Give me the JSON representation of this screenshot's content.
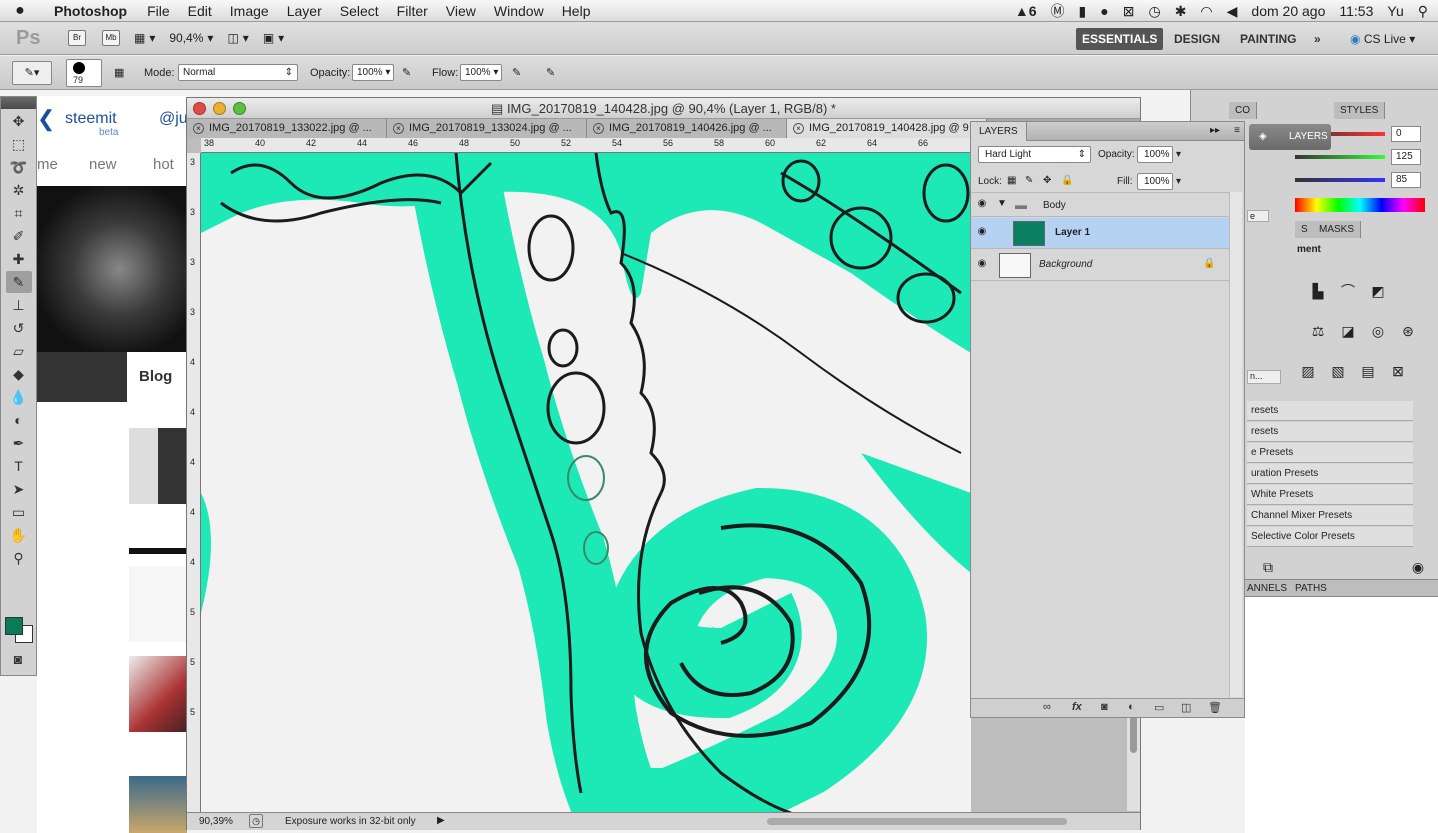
{
  "menubar": {
    "app_name": "Photoshop",
    "menus": [
      "File",
      "Edit",
      "Image",
      "Layer",
      "Select",
      "Filter",
      "View",
      "Window",
      "Help"
    ],
    "tray": {
      "adobe_badge": "6",
      "date": "dom 20 ago",
      "time": "11:53",
      "user": "Yu"
    }
  },
  "appbar": {
    "logo": "Ps",
    "bridge": "Br",
    "minibridge": "Mb",
    "zoom": "90,4%",
    "workspaces": [
      "ESSENTIALS",
      "DESIGN",
      "PAINTING"
    ],
    "more": "»",
    "cs_live": "CS Live"
  },
  "options": {
    "brush_size": "79",
    "mode_label": "Mode:",
    "mode_value": "Normal",
    "opacity_label": "Opacity:",
    "opacity_value": "100%",
    "flow_label": "Flow:",
    "flow_value": "100%"
  },
  "browser": {
    "brand": "steemit",
    "beta": "beta",
    "handle": "@ju",
    "nav": [
      "me",
      "new",
      "hot"
    ],
    "blog_tab": "Blog"
  },
  "document": {
    "title": "IMG_20170819_140428.jpg @ 90,4% (Layer 1, RGB/8) *",
    "tabs": [
      "IMG_20170819_133022.jpg @ ...",
      "IMG_20170819_133024.jpg @ ...",
      "IMG_20170819_140426.jpg @ ...",
      "IMG_20170819_140428.jpg @ 9"
    ],
    "ruler_h": [
      "38",
      "40",
      "42",
      "44",
      "46",
      "48",
      "50",
      "52",
      "54",
      "56",
      "58",
      "60",
      "62",
      "64",
      "66"
    ],
    "ruler_v": [
      "3",
      "3",
      "3",
      "3",
      "4",
      "4",
      "4",
      "4",
      "4",
      "5",
      "5",
      "5"
    ],
    "zoom_status": "90,39%",
    "status_message": "Exposure works in 32-bit only"
  },
  "layers_panel": {
    "title": "LAYERS",
    "blend_mode": "Hard Light",
    "opacity_label": "Opacity:",
    "opacity_value": "100%",
    "lock_label": "Lock:",
    "fill_label": "Fill:",
    "fill_value": "100%",
    "layers": [
      {
        "name": "Body",
        "type": "group"
      },
      {
        "name": "Layer 1",
        "type": "layer",
        "selected": true
      },
      {
        "name": "Background",
        "type": "background",
        "locked": true
      }
    ]
  },
  "right_panels": {
    "tab_co": "CO",
    "tab_styles": "STYLES",
    "layers_button": "LAYERS",
    "tab_s": "S",
    "tab_masks": "MASKS",
    "adjustments_title": "ment",
    "color_values": [
      "0",
      "125",
      "85"
    ],
    "presets": [
      "resets",
      "resets",
      "e Presets",
      "uration Presets",
      "White Presets",
      "Channel Mixer Presets",
      "Selective Color Presets"
    ],
    "fragments": [
      "e",
      "n..."
    ],
    "channels_tab": "ANNELS",
    "paths_tab": "PATHS"
  },
  "colors": {
    "foreground": "#0a7a5a",
    "background": "#ffffff",
    "paint": "#1de9b6",
    "accent_selected_layer": "#b5d2f3"
  }
}
